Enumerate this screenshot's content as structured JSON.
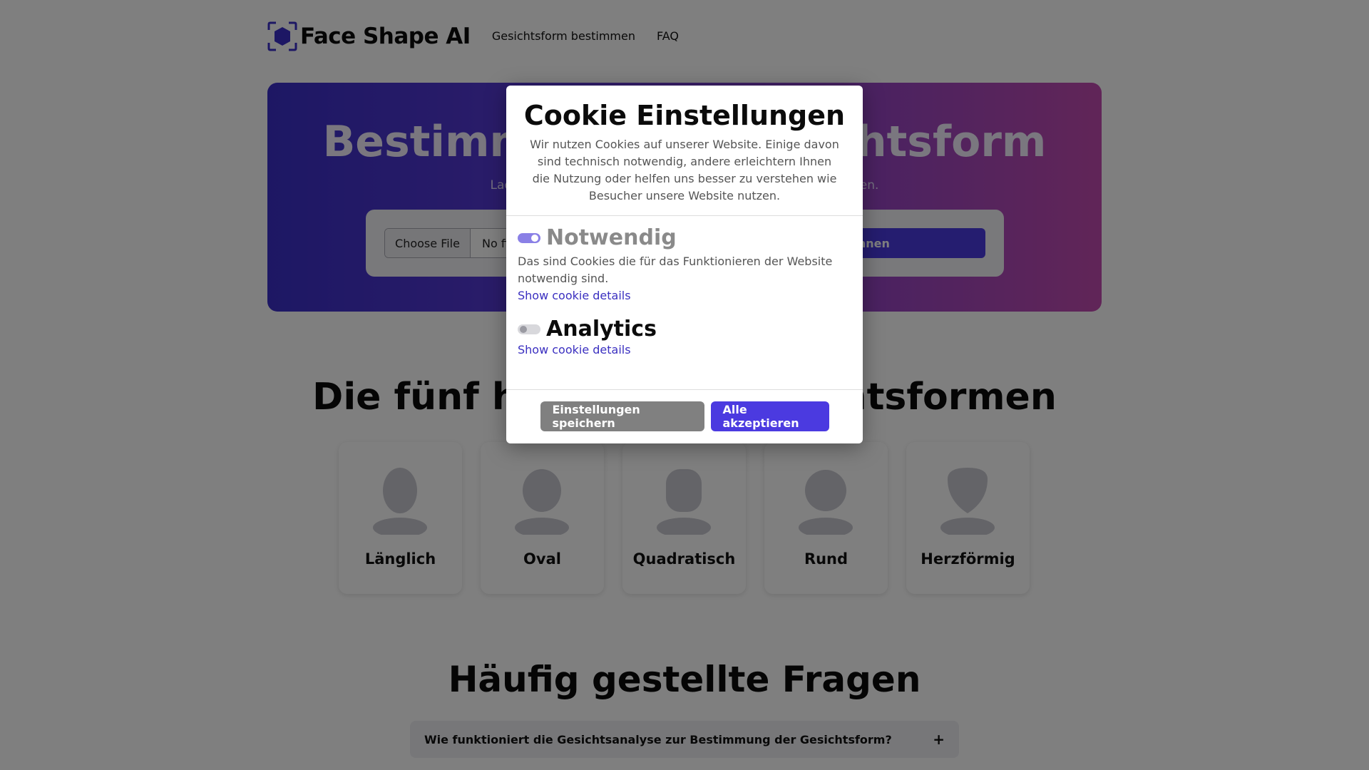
{
  "nav": {
    "brand": "Face Shape AI",
    "links": [
      "Gesichtsform bestimmen",
      "FAQ"
    ]
  },
  "hero": {
    "title": "Bestimme deine Gesichtsform",
    "subtitle": "Lade ein Foto hoch und lass deine Gesichtsform mit KI scannen.",
    "file_button": "Choose File",
    "file_status": "No file chosen",
    "scan_button": "Scannen"
  },
  "shapes": {
    "title": "Die fünf häufigsten Gesichtsformen",
    "cards": [
      "Länglich",
      "Oval",
      "Quadratisch",
      "Rund",
      "Herzförmig"
    ]
  },
  "faq": {
    "title": "Häufig gestellte Fragen",
    "items": [
      {
        "question": "Wie funktioniert die Gesichtsanalyse zur Bestimmung der Gesichtsform?",
        "toggle": "+"
      }
    ]
  },
  "cookie_modal": {
    "title": "Cookie Einstellungen",
    "description": "Wir nutzen Cookies auf unserer Website. Einige davon sind technisch notwendig, andere erleichtern Ihnen die Nutzung oder helfen uns besser zu verstehen wie Besucher unsere Website nutzen.",
    "categories": [
      {
        "name": "Notwendig",
        "enabled": true,
        "locked": true,
        "description": "Das sind Cookies die für das Funktionieren der Website notwendig sind.",
        "details_link": "Show cookie details"
      },
      {
        "name": "Analytics",
        "enabled": false,
        "locked": false,
        "description": "",
        "details_link": "Show cookie details"
      }
    ],
    "save_button": "Einstellungen speichern",
    "accept_button": "Alle akzeptieren"
  },
  "colors": {
    "accent": "#4b3ae0",
    "link": "#3a2fc0",
    "overlay": "rgba(0,0,0,0.5)"
  }
}
